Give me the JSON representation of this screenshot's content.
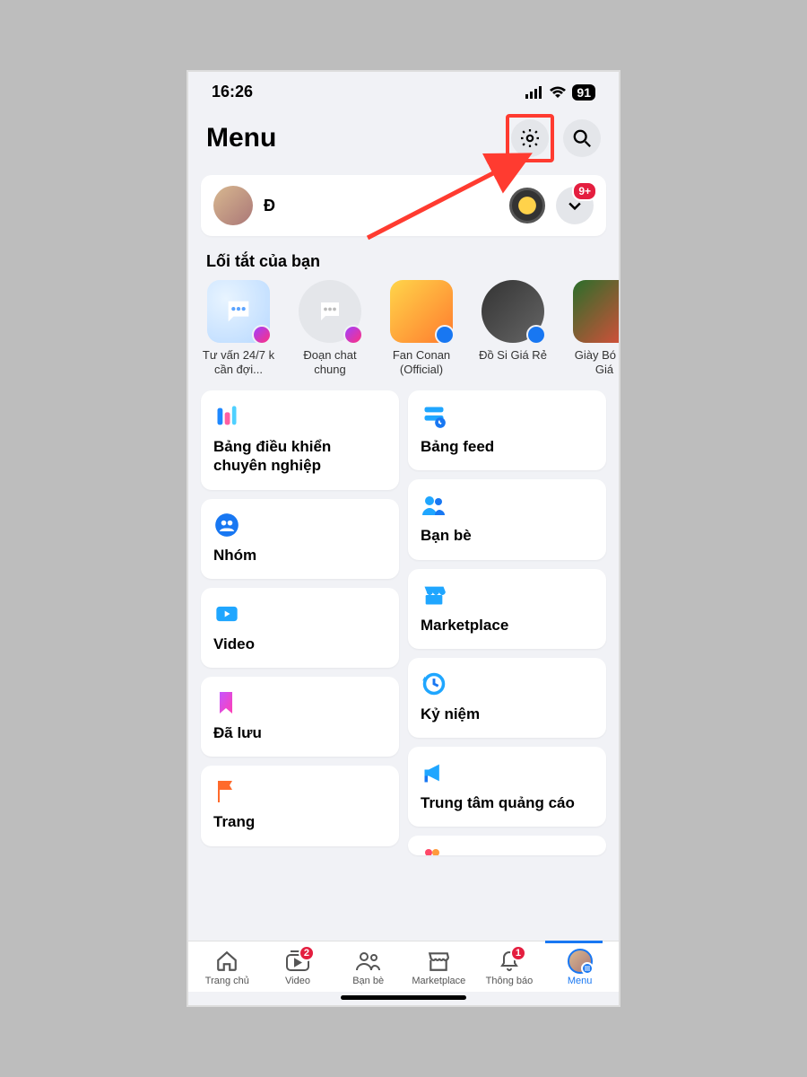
{
  "status": {
    "time": "16:26",
    "battery": "91"
  },
  "header": {
    "title": "Menu"
  },
  "profile": {
    "name": "Đ",
    "badge": "9+"
  },
  "shortcuts_title": "Lối tắt của bạn",
  "shortcuts": [
    {
      "label": "Tư vấn 24/7 k cần đợi..."
    },
    {
      "label": "Đoạn chat chung"
    },
    {
      "label": "Fan Conan (Official)"
    },
    {
      "label": "Đồ Si Giá Rẻ"
    },
    {
      "label": "Giày Bó Đá Giá"
    }
  ],
  "tiles_left": [
    {
      "label": "Bảng điều khiển chuyên nghiệp"
    },
    {
      "label": "Nhóm"
    },
    {
      "label": "Video"
    },
    {
      "label": "Đã lưu"
    },
    {
      "label": "Trang"
    }
  ],
  "tiles_right": [
    {
      "label": "Bảng feed"
    },
    {
      "label": "Bạn bè"
    },
    {
      "label": "Marketplace"
    },
    {
      "label": "Kỷ niệm"
    },
    {
      "label": "Trung tâm quảng cáo"
    }
  ],
  "nav": {
    "home": "Trang chủ",
    "video": "Video",
    "video_badge": "2",
    "friends": "Bạn bè",
    "marketplace": "Marketplace",
    "notifications": "Thông báo",
    "notifications_badge": "1",
    "menu": "Menu"
  }
}
